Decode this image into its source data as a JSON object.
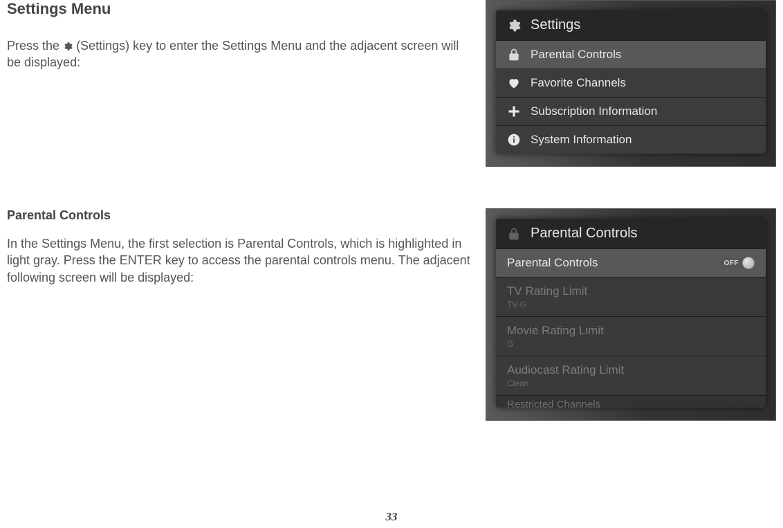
{
  "section1": {
    "heading": "Settings Menu",
    "para_a": "Press the ",
    "para_b": " (Settings) key to enter the Settings Menu and the adjacent screen will be displayed:",
    "screenshot": {
      "header_label": "Settings",
      "items": [
        {
          "icon": "lock-icon",
          "label": "Parental Controls"
        },
        {
          "icon": "heart-icon",
          "label": "Favorite Channels"
        },
        {
          "icon": "plus-icon",
          "label": "Subscription Information"
        },
        {
          "icon": "info-icon",
          "label": "System Information"
        }
      ]
    }
  },
  "section2": {
    "heading": "Parental Controls",
    "para": "In the Settings Menu, the first selection is Parental Controls, which is highlighted in light gray.  Press the ENTER key to access the parental controls menu.  The adjacent following screen will be displayed:",
    "screenshot": {
      "header_label": "Parental Controls",
      "toggle_row": {
        "label": "Parental Controls",
        "state": "OFF"
      },
      "rows": [
        {
          "label": "TV Rating Limit",
          "sub": "TV-G"
        },
        {
          "label": "Movie Rating Limit",
          "sub": "G"
        },
        {
          "label": "Audiocast Rating Limit",
          "sub": "Clean"
        }
      ],
      "cut_row_label": "Restricted Channels"
    }
  },
  "page_number": "33"
}
